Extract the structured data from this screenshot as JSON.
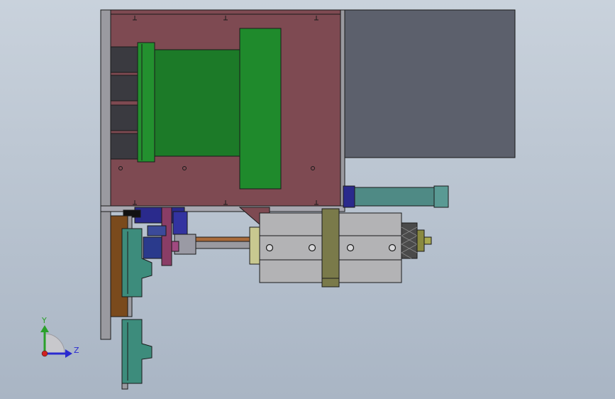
{
  "viewport": {
    "background_top": "#c9d2dc",
    "background_bottom": "#a9b5c4"
  },
  "colors": {
    "frame_plate": "#7e4a52",
    "green_part": "#1c7a28",
    "grey_box": "#5c606c",
    "cylinder_body": "#b3b3b5",
    "rod_teal": "#4f8a85",
    "teal_parts": "#3d8c7c",
    "navy_parts": "#2a2a8c",
    "magenta_bar": "#8a3d66",
    "olive_bracket": "#7a7a4a",
    "brown_plate": "#7a4a1c",
    "outline": "#1a1a1a"
  },
  "triad": {
    "y_axis_label": "Y",
    "z_axis_label": "Z",
    "y_axis_color": "#2aa02a",
    "z_axis_color": "#2a2ad0",
    "origin_color": "#d02020"
  }
}
